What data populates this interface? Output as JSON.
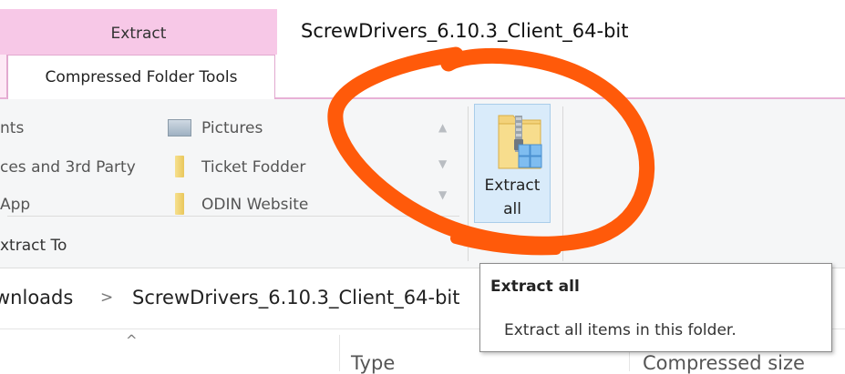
{
  "header": {
    "context_tab_label": "Extract",
    "window_title": "ScrewDrivers_6.10.3_Client_64-bit",
    "active_tab_label": "Compressed Folder Tools"
  },
  "ribbon": {
    "gallery_left": [
      {
        "label": "nts"
      },
      {
        "label": "ces and 3rd Party"
      },
      {
        "label": "App"
      }
    ],
    "gallery_right": [
      {
        "label": "Pictures",
        "icon": "pictures-icon"
      },
      {
        "label": "Ticket Fodder",
        "icon": "folder-icon"
      },
      {
        "label": "ODIN Website",
        "icon": "folder-icon"
      }
    ],
    "group_label": "xtract To",
    "extract_all": {
      "line1": "Extract",
      "line2": "all",
      "icon": "zip-folder-icon"
    }
  },
  "address": {
    "partial_segment": "wnloads",
    "separator": ">",
    "current_folder": "ScrewDrivers_6.10.3_Client_64-bit"
  },
  "columns": {
    "sort_indicator": "^",
    "type": "Type",
    "compressed_size": "Compressed size"
  },
  "tooltip": {
    "title": "Extract all",
    "description": "Extract all items in this folder."
  },
  "colors": {
    "context_tab": "#f7c8e7",
    "annotation": "#ff5a0a",
    "button_highlight": "#d9ebfa"
  }
}
